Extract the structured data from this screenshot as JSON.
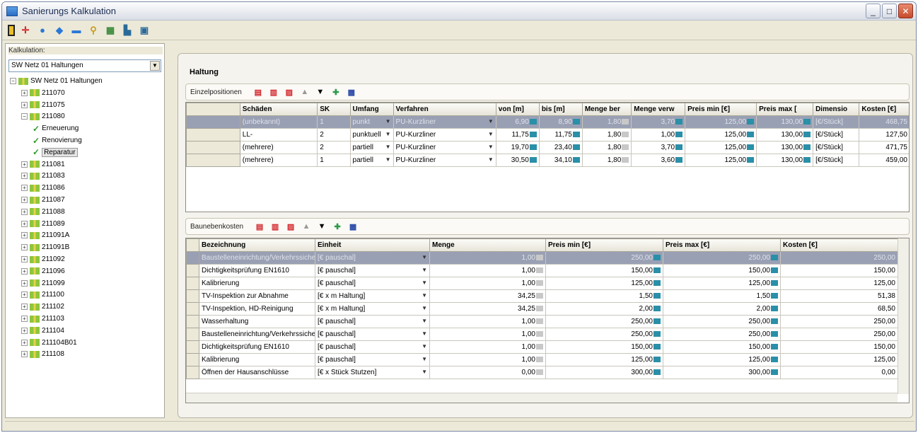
{
  "window": {
    "title": "Sanierungs Kalkulation",
    "min": "_",
    "max": "□",
    "close": "✕"
  },
  "toolbar": {
    "icons": [
      "door-icon",
      "add-icon",
      "circle-icon",
      "diamond-icon",
      "minus-icon",
      "search-icon",
      "grid-icon",
      "chart-icon",
      "export-icon"
    ]
  },
  "left": {
    "label": "Kalkulation:",
    "combo_value": "SW Netz 01 Haltungen",
    "tree": [
      {
        "label": "SW Netz 01 Haltungen",
        "level": 0,
        "type": "root"
      },
      {
        "label": "211070",
        "level": 1,
        "type": "node"
      },
      {
        "label": "211075",
        "level": 1,
        "type": "node"
      },
      {
        "label": "211080",
        "level": 1,
        "type": "node",
        "expanded": true
      },
      {
        "label": "Erneuerung",
        "level": 2,
        "type": "check"
      },
      {
        "label": "Renovierung",
        "level": 2,
        "type": "check"
      },
      {
        "label": "Reparatur",
        "level": 2,
        "type": "check",
        "selected": true
      },
      {
        "label": "211081",
        "level": 1,
        "type": "node"
      },
      {
        "label": "211083",
        "level": 1,
        "type": "node"
      },
      {
        "label": "211086",
        "level": 1,
        "type": "node"
      },
      {
        "label": "211087",
        "level": 1,
        "type": "node"
      },
      {
        "label": "211088",
        "level": 1,
        "type": "node"
      },
      {
        "label": "211089",
        "level": 1,
        "type": "node"
      },
      {
        "label": "211091A",
        "level": 1,
        "type": "node"
      },
      {
        "label": "211091B",
        "level": 1,
        "type": "node"
      },
      {
        "label": "211092",
        "level": 1,
        "type": "node"
      },
      {
        "label": "211096",
        "level": 1,
        "type": "node"
      },
      {
        "label": "211099",
        "level": 1,
        "type": "node"
      },
      {
        "label": "211100",
        "level": 1,
        "type": "node"
      },
      {
        "label": "211102",
        "level": 1,
        "type": "node"
      },
      {
        "label": "211103",
        "level": 1,
        "type": "node"
      },
      {
        "label": "211104",
        "level": 1,
        "type": "node"
      },
      {
        "label": "211104B01",
        "level": 1,
        "type": "node"
      },
      {
        "label": "211108",
        "level": 1,
        "type": "node"
      }
    ]
  },
  "main": {
    "header": "Haltung",
    "einzel": {
      "label": "Einzelpositionen",
      "columns": [
        "Schäden",
        "SK",
        "Umfang",
        "Verfahren",
        "von [m]",
        "bis [m]",
        "Menge ber",
        "Menge verw",
        "Preis min [€]",
        "Preis max [",
        "Dimensio",
        "Kosten [€]"
      ],
      "rows": [
        {
          "sel": true,
          "c": [
            "(unbekannt)",
            "1",
            "punkt",
            "PU-Kurzliner",
            "6,90",
            "8,90",
            "1,80",
            "3,70",
            "125,00",
            "130,00",
            "[€/Stück]",
            "468,75"
          ]
        },
        {
          "sel": false,
          "c": [
            "LL-",
            "2",
            "punktuell",
            "PU-Kurzliner",
            "11,75",
            "11,75",
            "1,80",
            "1,00",
            "125,00",
            "130,00",
            "[€/Stück]",
            "127,50"
          ]
        },
        {
          "sel": false,
          "c": [
            "(mehrere)",
            "2",
            "partiell",
            "PU-Kurzliner",
            "19,70",
            "23,40",
            "1,80",
            "3,70",
            "125,00",
            "130,00",
            "[€/Stück]",
            "471,75"
          ]
        },
        {
          "sel": false,
          "c": [
            "(mehrere)",
            "1",
            "partiell",
            "PU-Kurzliner",
            "30,50",
            "34,10",
            "1,80",
            "3,60",
            "125,00",
            "130,00",
            "[€/Stück]",
            "459,00"
          ]
        }
      ]
    },
    "bau": {
      "label": "Baunebenkosten",
      "columns": [
        "Bezeichnung",
        "Einheit",
        "Menge",
        "Preis min [€]",
        "Preis max [€]",
        "Kosten [€]"
      ],
      "rows": [
        {
          "sel": true,
          "c": [
            "Baustelleneinrichtung/Verkehrssicherung",
            "[€ pauschal]",
            "1,00",
            "250,00",
            "250,00",
            "250,00"
          ]
        },
        {
          "sel": false,
          "c": [
            "Dichtigkeitsprüfung EN1610",
            "[€ pauschal]",
            "1,00",
            "150,00",
            "150,00",
            "150,00"
          ]
        },
        {
          "sel": false,
          "c": [
            "Kalibrierung",
            "[€ pauschal]",
            "1,00",
            "125,00",
            "125,00",
            "125,00"
          ]
        },
        {
          "sel": false,
          "c": [
            "TV-Inspektion zur Abnahme",
            "[€ x m Haltung]",
            "34,25",
            "1,50",
            "1,50",
            "51,38"
          ]
        },
        {
          "sel": false,
          "c": [
            "TV-Inspektion, HD-Reinigung",
            "[€ x m Haltung]",
            "34,25",
            "2,00",
            "2,00",
            "68,50"
          ]
        },
        {
          "sel": false,
          "c": [
            "Wasserhaltung",
            "[€ pauschal]",
            "1,00",
            "250,00",
            "250,00",
            "250,00"
          ]
        },
        {
          "sel": false,
          "c": [
            "Baustelleneinrichtung/Verkehrssicherung",
            "[€ pauschal]",
            "1,00",
            "250,00",
            "250,00",
            "250,00"
          ]
        },
        {
          "sel": false,
          "c": [
            "Dichtigkeitsprüfung EN1610",
            "[€ pauschal]",
            "1,00",
            "150,00",
            "150,00",
            "150,00"
          ]
        },
        {
          "sel": false,
          "c": [
            "Kalibrierung",
            "[€ pauschal]",
            "1,00",
            "125,00",
            "125,00",
            "125,00"
          ]
        },
        {
          "sel": false,
          "c": [
            "Öffnen der Hausanschlüsse",
            "[€ x Stück Stutzen]",
            "0,00",
            "300,00",
            "300,00",
            "0,00"
          ]
        }
      ]
    }
  }
}
